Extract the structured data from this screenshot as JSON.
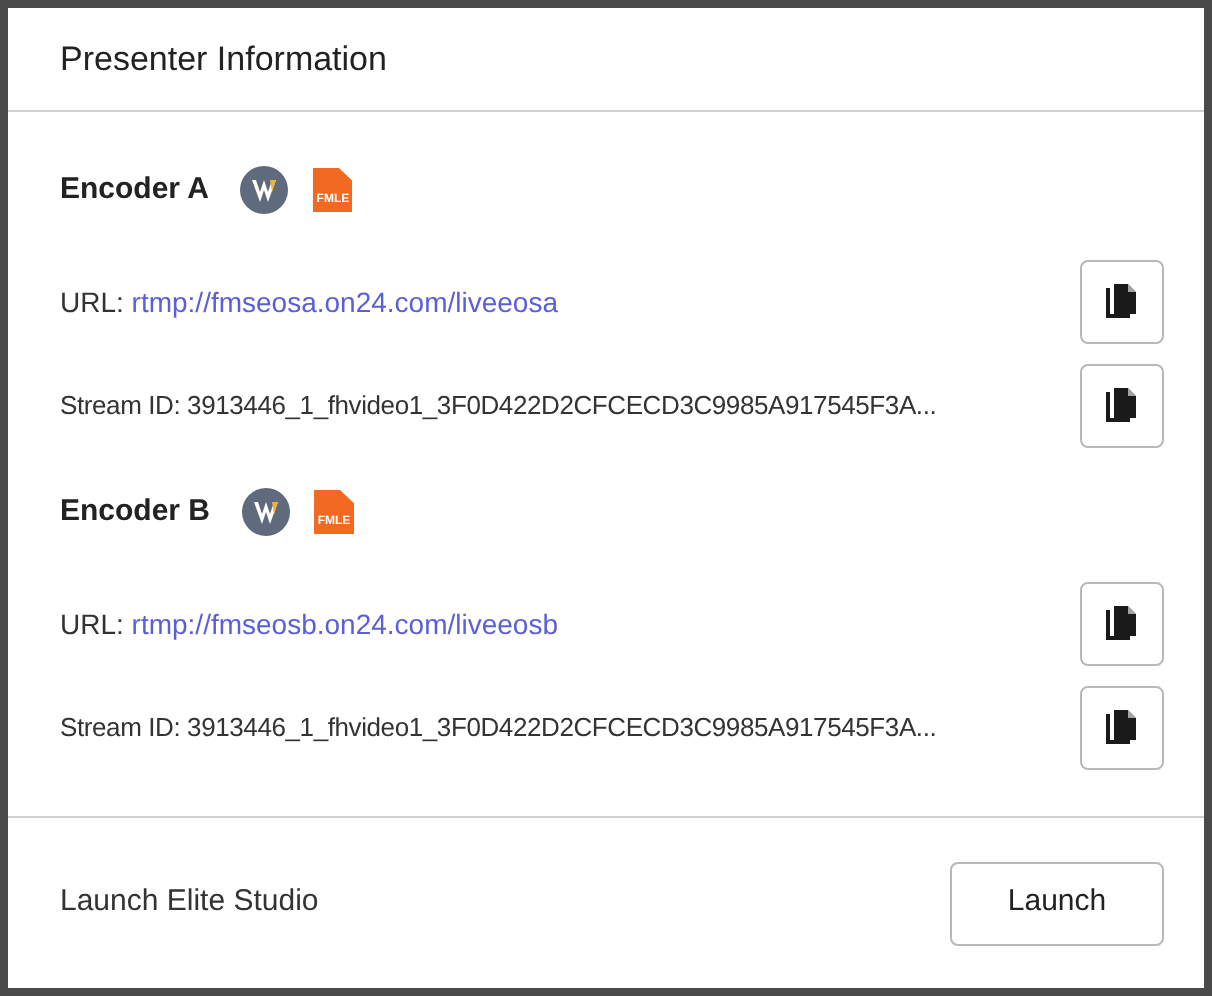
{
  "title": "Presenter Information",
  "encoders": [
    {
      "name": "Encoder A",
      "fmle_label": "FMLE",
      "url_label": "URL:",
      "url": "rtmp://fmseosa.on24.com/liveeosa",
      "stream_label": "Stream ID:",
      "stream_id": "3913446_1_fhvideo1_3F0D422D2CFCECD3C9985A917545F3A..."
    },
    {
      "name": "Encoder B",
      "fmle_label": "FMLE",
      "url_label": "URL:",
      "url": "rtmp://fmseosb.on24.com/liveeosb",
      "stream_label": "Stream ID:",
      "stream_id": "3913446_1_fhvideo1_3F0D422D2CFCECD3C9985A917545F3A..."
    }
  ],
  "footer": {
    "label": "Launch Elite Studio",
    "button": "Launch"
  }
}
